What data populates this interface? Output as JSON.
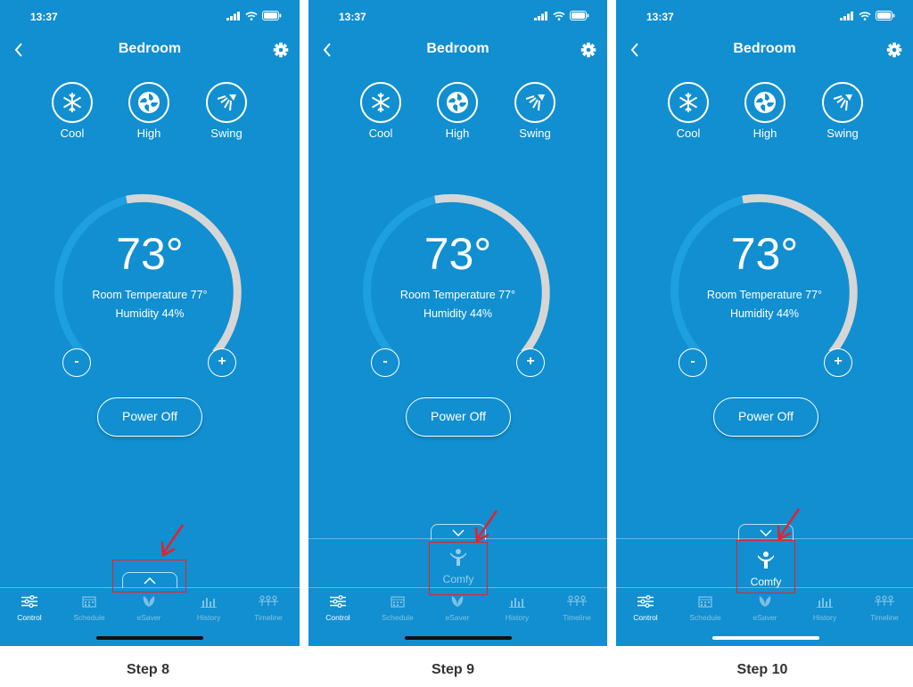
{
  "status": {
    "time": "13:37"
  },
  "nav": {
    "title": "Bedroom"
  },
  "modes": [
    {
      "label": "Cool",
      "icon": "snowflake-icon"
    },
    {
      "label": "High",
      "icon": "fan-icon"
    },
    {
      "label": "Swing",
      "icon": "swing-icon"
    }
  ],
  "thermostat": {
    "set_temp": "73°",
    "room_temp": "Room Temperature 77°",
    "humidity": "Humidity 44%",
    "minus_label": "-",
    "plus_label": "+"
  },
  "power_button": "Power Off",
  "comfy_label": "Comfy",
  "tabs": [
    "Control",
    "Schedule",
    "eSaver",
    "History",
    "Timeline"
  ],
  "steps": [
    "Step 8",
    "Step 9",
    "Step 10"
  ],
  "colors": {
    "background": "#118fd0",
    "dial_track": "#d6d6d6",
    "dial_fill": "#1d9fe0",
    "highlight": "#e5212b"
  }
}
